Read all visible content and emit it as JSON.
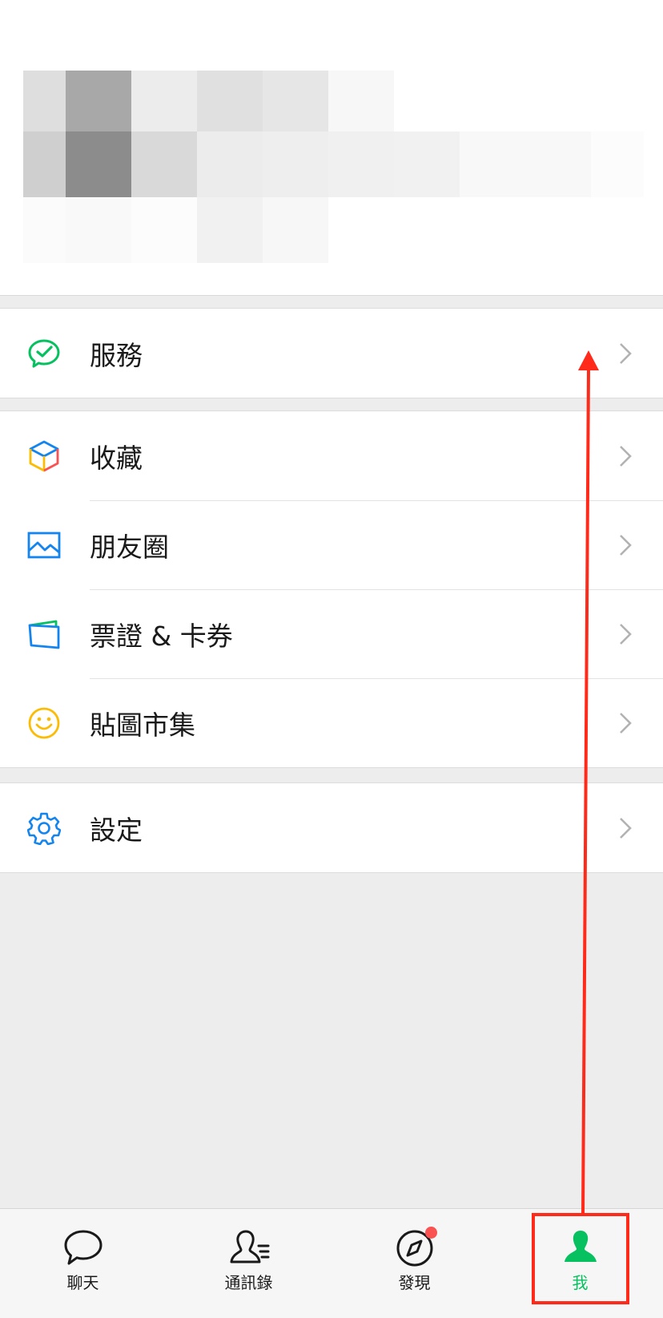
{
  "menu": {
    "group1": [
      {
        "label": "服務",
        "icon": "wechat-pay-icon"
      }
    ],
    "group2": [
      {
        "label": "收藏",
        "icon": "favorites-cube-icon"
      },
      {
        "label": "朋友圈",
        "icon": "moments-picture-icon"
      },
      {
        "label": "票證 & 卡券",
        "icon": "card-icon"
      },
      {
        "label": "貼圖市集",
        "icon": "sticker-smile-icon"
      }
    ],
    "group3": [
      {
        "label": "設定",
        "icon": "settings-gear-icon"
      }
    ]
  },
  "tabbar": {
    "tabs": [
      {
        "label": "聊天",
        "icon": "chat-bubble-icon",
        "active": false
      },
      {
        "label": "通訊錄",
        "icon": "contacts-icon",
        "active": false
      },
      {
        "label": "發現",
        "icon": "compass-icon",
        "active": false,
        "badge": true
      },
      {
        "label": "我",
        "icon": "me-person-icon",
        "active": true
      }
    ]
  },
  "colors": {
    "accent": "#07c160",
    "annotation": "#ff2a1a",
    "badge": "#fa5151"
  }
}
